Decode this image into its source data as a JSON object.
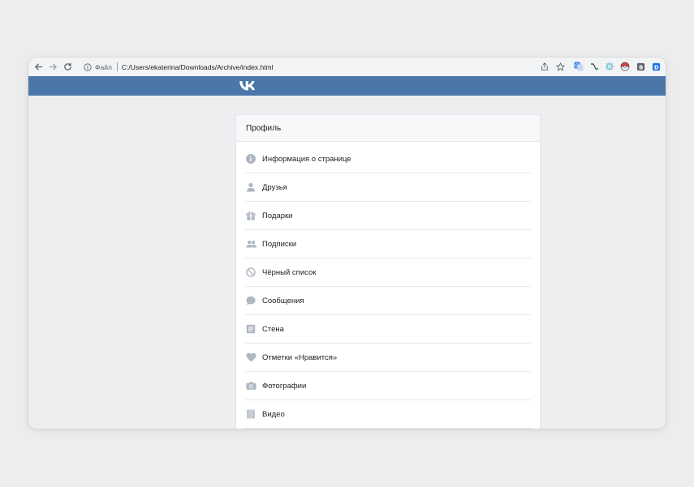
{
  "browser": {
    "scheme_label": "Файл",
    "url": "C:/Users/ekaterina/Downloads/Archive/index.html",
    "extensions": [
      "share-icon",
      "star-icon",
      "translate-icon",
      "pen-extension-icon",
      "cog-extension-icon",
      "pokeball-extension-icon",
      "b-extension-icon",
      "d-extension-icon"
    ]
  },
  "colors": {
    "header": "#4a76a8",
    "icon": "#aeb7c2",
    "page_bg": "#edeef0"
  },
  "profile": {
    "title": "Профиль",
    "items": [
      {
        "label": "Информация о странице",
        "icon": "info-icon"
      },
      {
        "label": "Друзья",
        "icon": "user-icon"
      },
      {
        "label": "Подарки",
        "icon": "gift-icon"
      },
      {
        "label": "Подписки",
        "icon": "users-icon"
      },
      {
        "label": "Чёрный список",
        "icon": "block-icon"
      },
      {
        "label": "Сообщения",
        "icon": "message-icon"
      },
      {
        "label": "Стена",
        "icon": "wall-icon"
      },
      {
        "label": "Отметки «Нравится»",
        "icon": "heart-icon"
      },
      {
        "label": "Фотографии",
        "icon": "camera-icon"
      },
      {
        "label": "Видео",
        "icon": "video-icon"
      }
    ]
  }
}
